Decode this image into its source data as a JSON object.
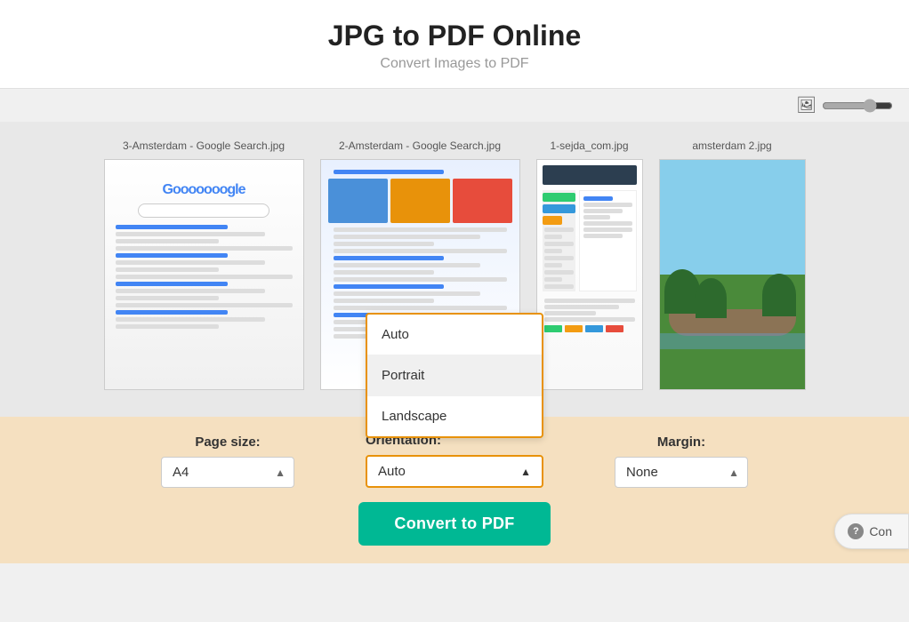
{
  "header": {
    "title": "JPG to PDF Online",
    "subtitle": "Convert Images to PDF"
  },
  "toolbar": {
    "zoom_icon": "🖼",
    "zoom_value": 75
  },
  "images": [
    {
      "filename": "3-Amsterdam - Google Search.jpg",
      "type": "google1"
    },
    {
      "filename": "2-Amsterdam - Google Search.jpg",
      "type": "google2"
    },
    {
      "filename": "1-sejda_com.jpg",
      "type": "sejda"
    },
    {
      "filename": "amsterdam 2.jpg",
      "type": "amsterdam"
    }
  ],
  "controls": {
    "page_size_label": "Page size:",
    "page_size_value": "A4",
    "orientation_label": "Orientation:",
    "orientation_value": "Auto",
    "margin_label": "Margin:",
    "margin_value": "None",
    "orientation_options": [
      {
        "value": "Auto",
        "highlighted": false
      },
      {
        "value": "Portrait",
        "highlighted": true
      },
      {
        "value": "Landscape",
        "highlighted": false
      }
    ]
  },
  "actions": {
    "convert_label": "Convert to PDF",
    "con_label": "Con"
  }
}
